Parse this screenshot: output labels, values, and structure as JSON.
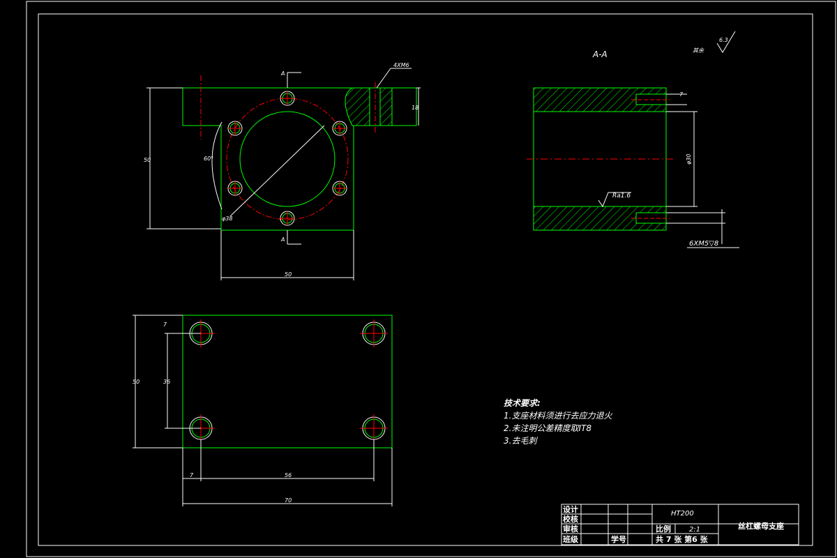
{
  "section_label": "A-A",
  "section_marker_top": "A",
  "section_marker_bottom": "A",
  "rest_label": "其余",
  "rest_roughness": "6.3",
  "thread_label_top": "4XM6",
  "front_view": {
    "dim_height": "50",
    "dim_width": "50",
    "dim_flange": "18",
    "dim_angle": "60°",
    "dim_pcd": "φ38"
  },
  "section_view": {
    "dim_bore": "φ30",
    "dim_7": "7",
    "roughness": "Ra1.6",
    "thread_callout": "6XM5▽8"
  },
  "top_view": {
    "dim_height": "50",
    "dim_36": "36",
    "dim_7_v": "7",
    "dim_7_h": "7",
    "dim_56": "56",
    "dim_70": "70"
  },
  "tech_req": {
    "title": "技术要求:",
    "items": [
      "1.支座材料须进行去应力退火",
      "2.未注明公差精度取IT8",
      "3.去毛刺"
    ]
  },
  "title_block": {
    "row_design": "设计",
    "row_check": "校核",
    "row_review": "审核",
    "row_class": "班级",
    "student_id": "学号",
    "material": "HT200",
    "scale_label": "比例",
    "scale_value": "2:1",
    "part_name": "丝杠螺母支座",
    "sheets": "共 7 张 第6 张"
  }
}
